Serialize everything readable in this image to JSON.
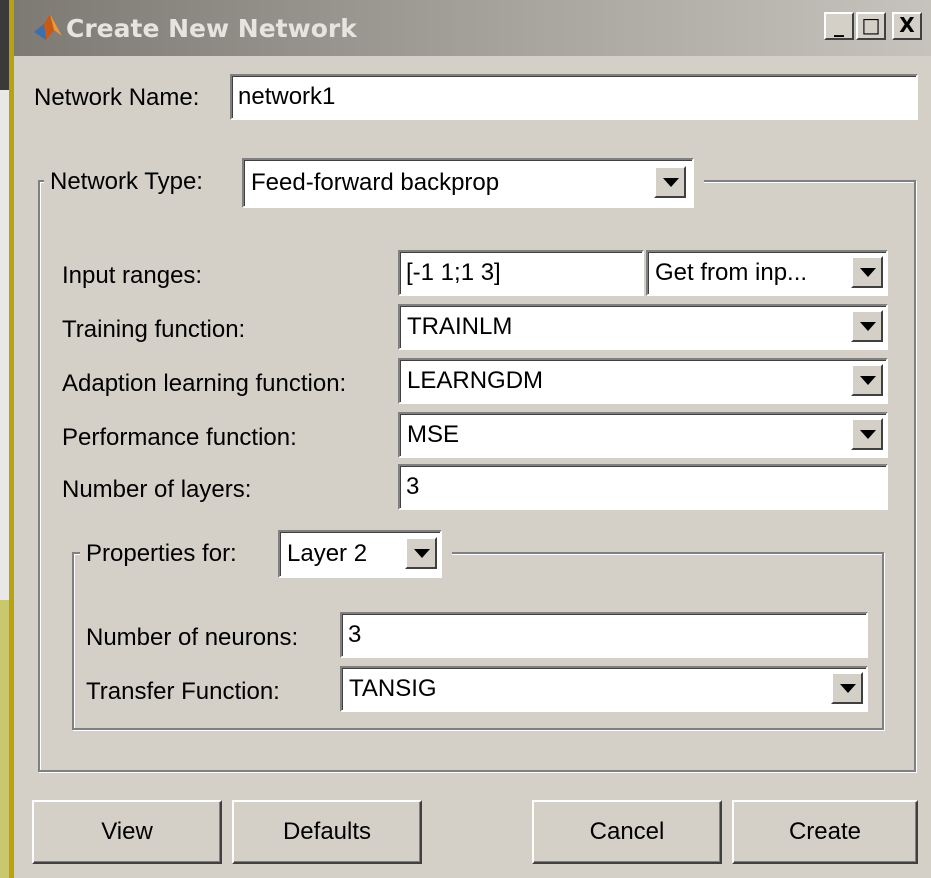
{
  "window": {
    "title": "Create New Network",
    "controls": {
      "minimize": "_",
      "maximize": "□",
      "close": "X"
    }
  },
  "network_name": {
    "label": "Network Name:",
    "value": "network1"
  },
  "network_type": {
    "label": "Network Type:",
    "value": "Feed-forward backprop"
  },
  "params": {
    "input_ranges": {
      "label": "Input ranges:",
      "value": "[-1 1;1 3]",
      "source_option": "Get from inp..."
    },
    "training_function": {
      "label": "Training function:",
      "value": "TRAINLM"
    },
    "adaption_learning_function": {
      "label": "Adaption learning function:",
      "value": "LEARNGDM"
    },
    "performance_function": {
      "label": "Performance function:",
      "value": "MSE"
    },
    "number_of_layers": {
      "label": "Number of layers:",
      "value": "3"
    }
  },
  "layer_properties": {
    "label": "Properties for:",
    "selected_layer": "Layer 2",
    "number_of_neurons": {
      "label": "Number of neurons:",
      "value": "3"
    },
    "transfer_function": {
      "label": "Transfer Function:",
      "value": "TANSIG"
    }
  },
  "buttons": {
    "view": "View",
    "defaults": "Defaults",
    "cancel": "Cancel",
    "create": "Create"
  },
  "icons": [
    "matlab-logo-icon",
    "chevron-down-icon",
    "minimize-icon",
    "maximize-icon",
    "close-icon"
  ],
  "colors": {
    "dialog_bg": "#d4d0c8",
    "titlebar_inactive": "#7d7a73",
    "field_bg": "#ffffff"
  }
}
